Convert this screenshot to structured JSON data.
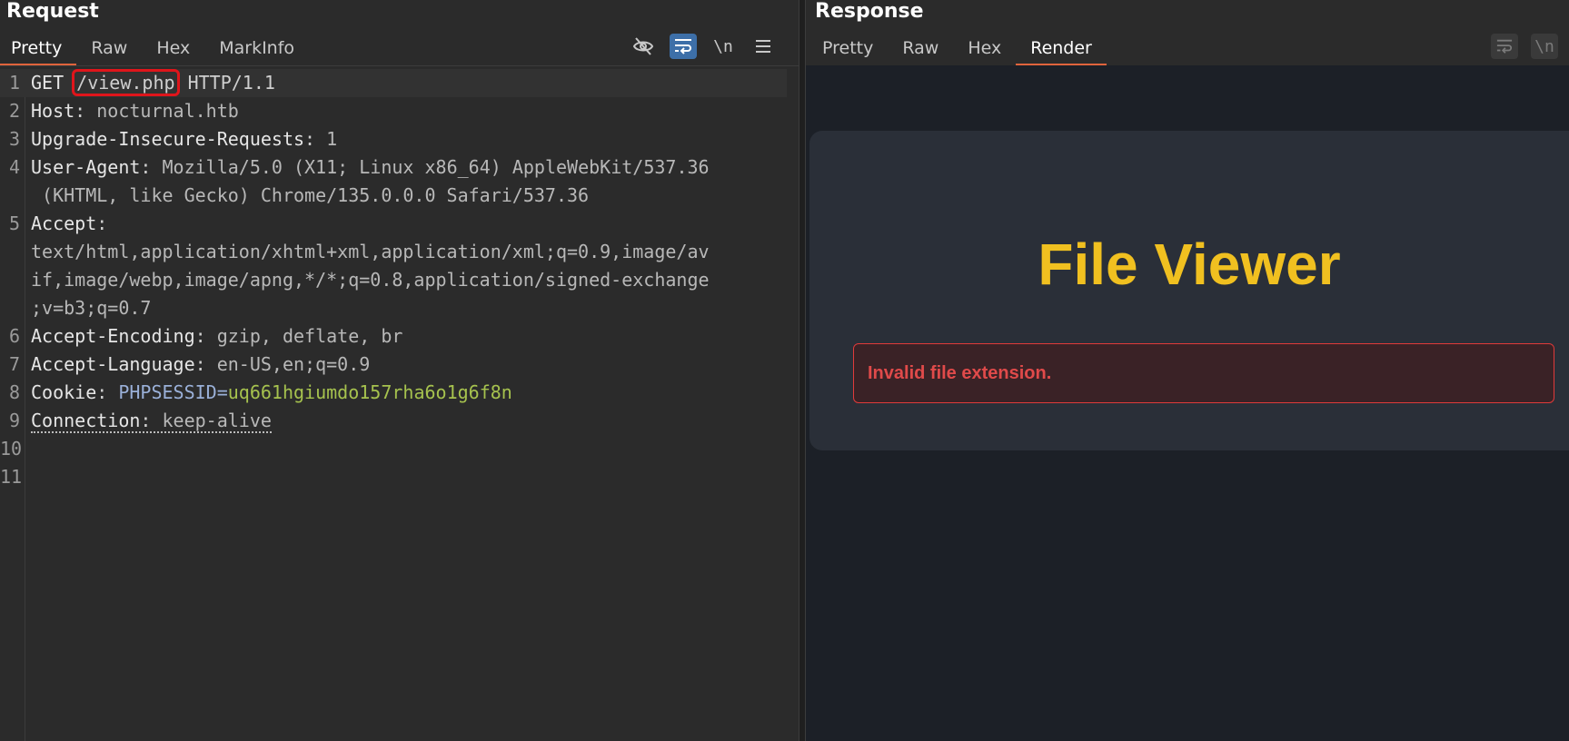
{
  "request": {
    "title": "Request",
    "tabs": [
      "Pretty",
      "Raw",
      "Hex",
      "MarkInfo"
    ],
    "active_tab": "Pretty",
    "toolbar_icons": [
      "eye-slash-icon",
      "wrap-icon",
      "newline-icon",
      "menu-icon"
    ],
    "newline_label": "\\n",
    "lines": {
      "l1": {
        "method": "GET",
        "path": "/view.php",
        "proto": "HTTP/1.1"
      },
      "l2": {
        "key": "Host",
        "value": "nocturnal.htb"
      },
      "l3": {
        "key": "Upgrade-Insecure-Requests",
        "value": "1"
      },
      "l4": {
        "key": "User-Agent",
        "value": "Mozilla/5.0 (X11; Linux x86_64) AppleWebKit/537.36",
        "value_cont": " (KHTML, like Gecko) Chrome/135.0.0.0 Safari/537.36"
      },
      "l5": {
        "key": "Accept",
        "value1": "text/html,application/xhtml+xml,application/xml;q=0.9,image/av",
        "value2": "if,image/webp,image/apng,*/*;q=0.8,application/signed-exchange",
        "value3": ";v=b3;q=0.7"
      },
      "l6": {
        "key": "Accept-Encoding",
        "value": "gzip, deflate, br"
      },
      "l7": {
        "key": "Accept-Language",
        "value": "en-US,en;q=0.9"
      },
      "l8": {
        "key": "Cookie",
        "cookie_name": "PHPSESSID",
        "cookie_value": "uq661hgiumdo157rha6o1g6f8n"
      },
      "l9": {
        "key": "Connection",
        "value": "keep-alive"
      }
    },
    "line_numbers": [
      "1",
      "2",
      "3",
      "4",
      "5",
      "6",
      "7",
      "8",
      "9",
      "10",
      "11"
    ]
  },
  "response": {
    "title": "Response",
    "tabs": [
      "Pretty",
      "Raw",
      "Hex",
      "Render"
    ],
    "active_tab": "Render",
    "toolbar_icons": [
      "wrap-icon",
      "newline-icon"
    ],
    "newline_label": "\\n",
    "render": {
      "heading": "File Viewer",
      "error": "Invalid file extension."
    }
  },
  "colors": {
    "accent_tab": "#e0643c",
    "highlight_box": "#e0151b",
    "heading": "#f0c020",
    "error": "#e04a4a"
  }
}
